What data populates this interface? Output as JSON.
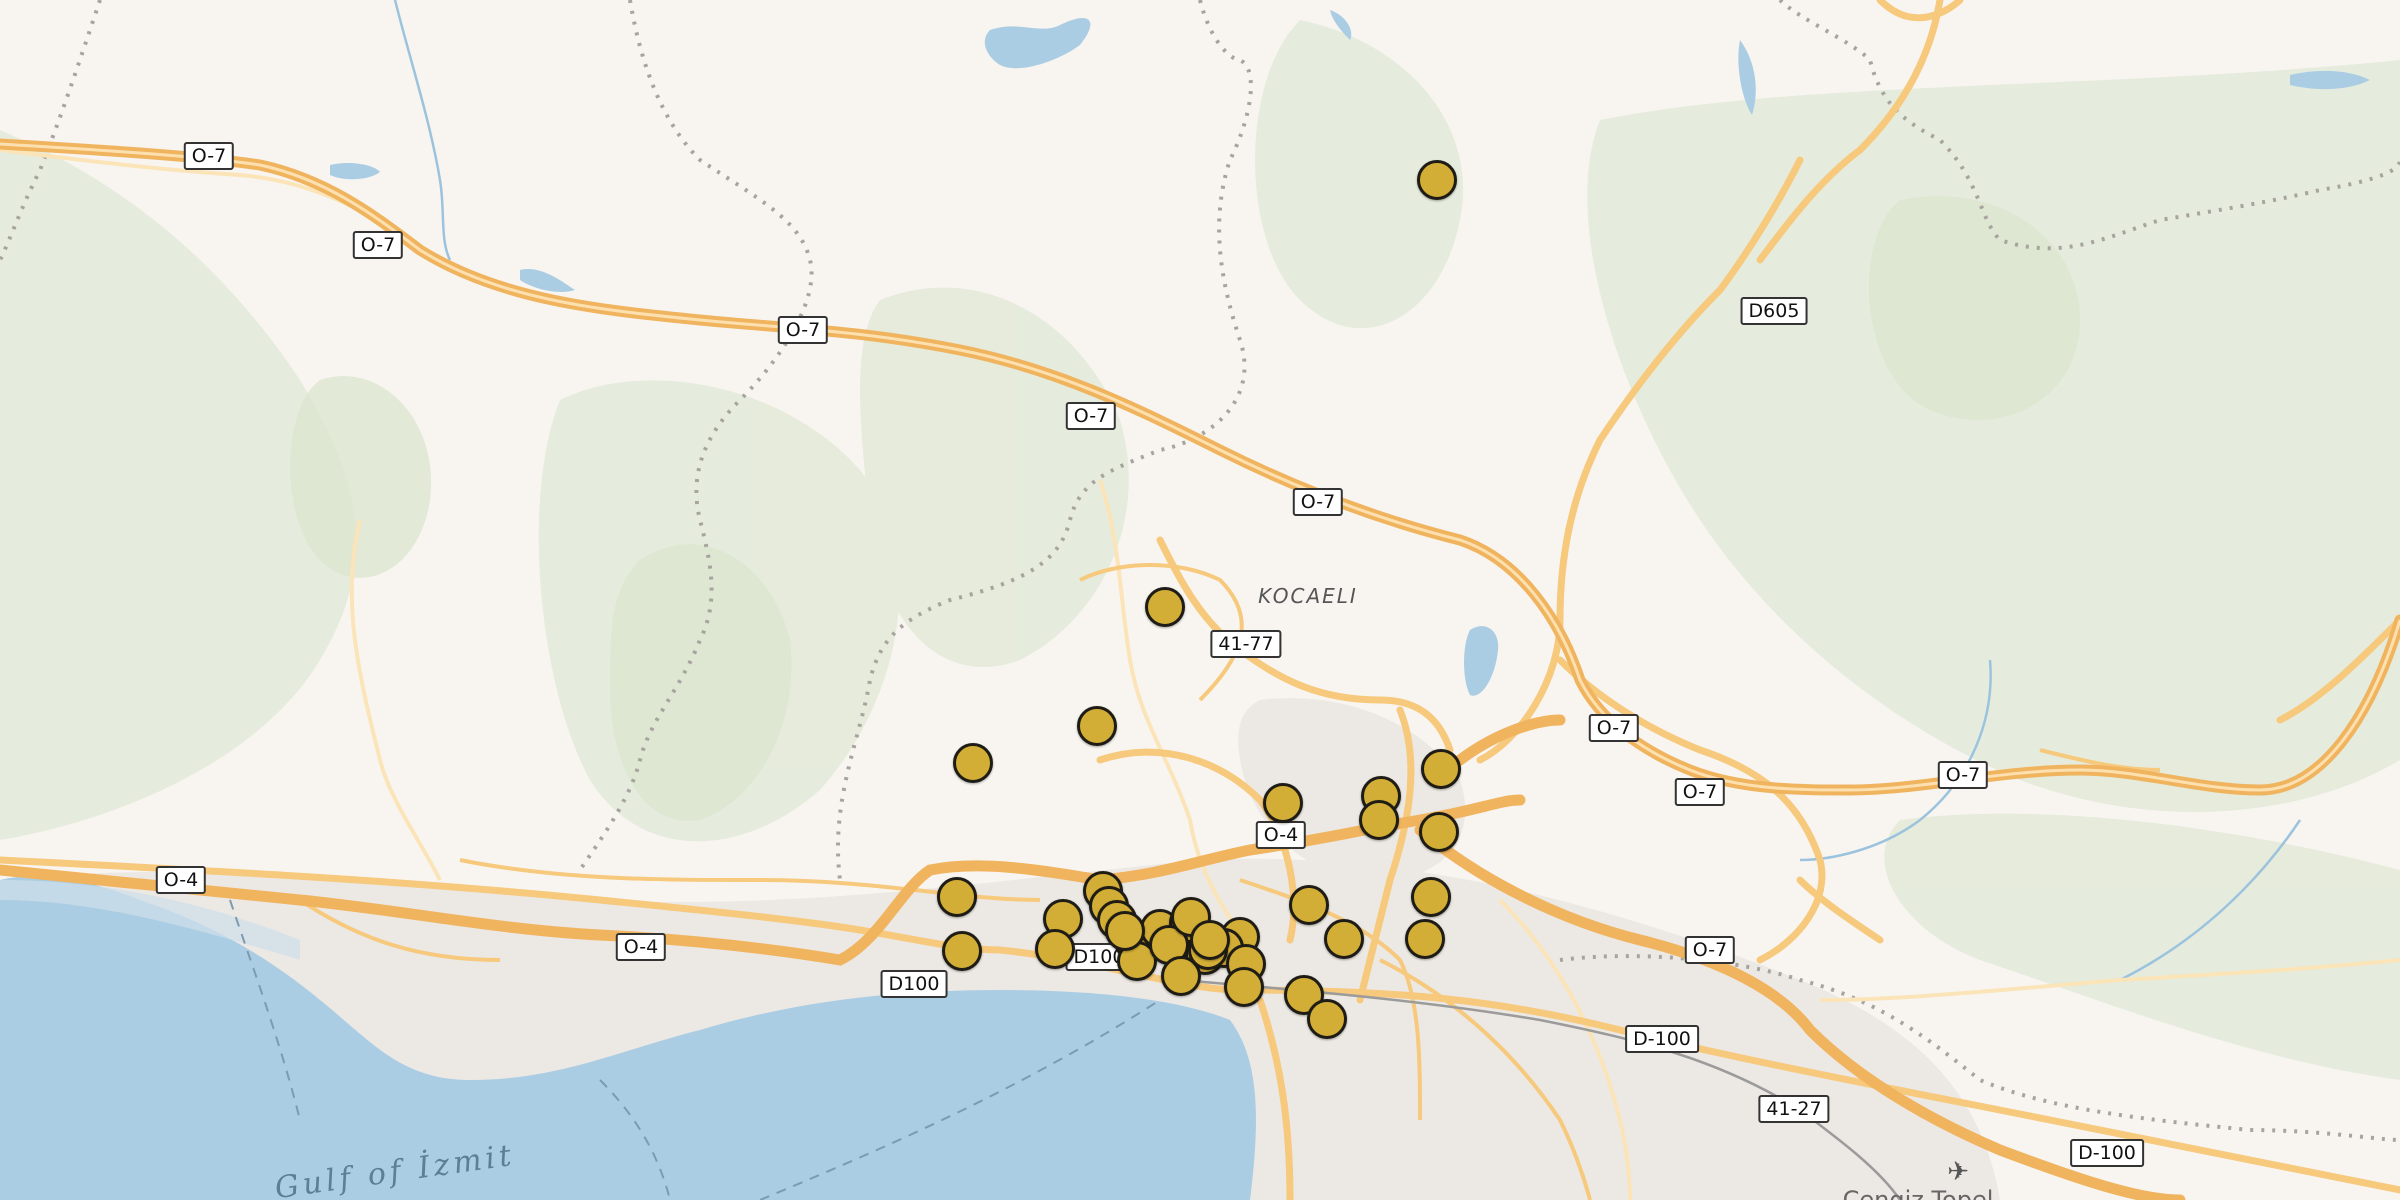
{
  "map": {
    "region_label": "KOCAELI",
    "water_label": "Gulf of İzmit",
    "city_label": "Cengiz Topel",
    "airport_icon": "airplane-icon",
    "marker_color": "#d3ae36",
    "marker_count": 37,
    "road_shields": [
      "O-7",
      "O-7",
      "O-7",
      "O-7",
      "O-7",
      "O-7",
      "O-7",
      "O-7",
      "O-7",
      "D605",
      "41-77",
      "O-4",
      "O-4",
      "O-4",
      "D100",
      "D100",
      "D-100",
      "D-100",
      "41-27"
    ]
  }
}
